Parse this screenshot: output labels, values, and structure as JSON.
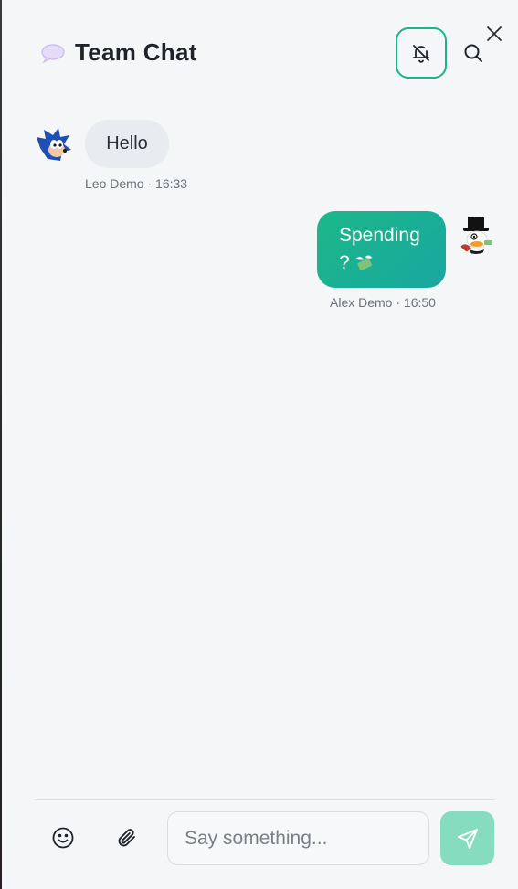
{
  "header": {
    "title": "Team Chat",
    "title_icon": "speech-bubble-icon",
    "mute_icon": "bell-off-icon",
    "search_icon": "search-icon",
    "close_icon": "close-icon"
  },
  "messages": [
    {
      "author": "Leo Demo",
      "time": "16:33",
      "meta": "Leo Demo · 16:33",
      "text": "Hello",
      "direction": "incoming",
      "avatar": "hedgehog-avatar"
    },
    {
      "author": "Alex Demo",
      "time": "16:50",
      "meta": "Alex Demo · 16:50",
      "text_line1": "Spending",
      "text_line2": "?",
      "emoji": "money-with-wings-icon",
      "direction": "outgoing",
      "avatar": "duck-top-hat-avatar"
    }
  ],
  "composer": {
    "placeholder": "Say something...",
    "emoji_icon": "smiley-icon",
    "attach_icon": "paperclip-icon",
    "send_icon": "send-icon"
  },
  "colors": {
    "accent": "#1db489",
    "bubble_out_start": "#1bb889",
    "bubble_out_end": "#1aa7a0",
    "bubble_in": "#e8ebef",
    "send_disabled": "#86dcbf",
    "background": "#f4f6f8"
  }
}
